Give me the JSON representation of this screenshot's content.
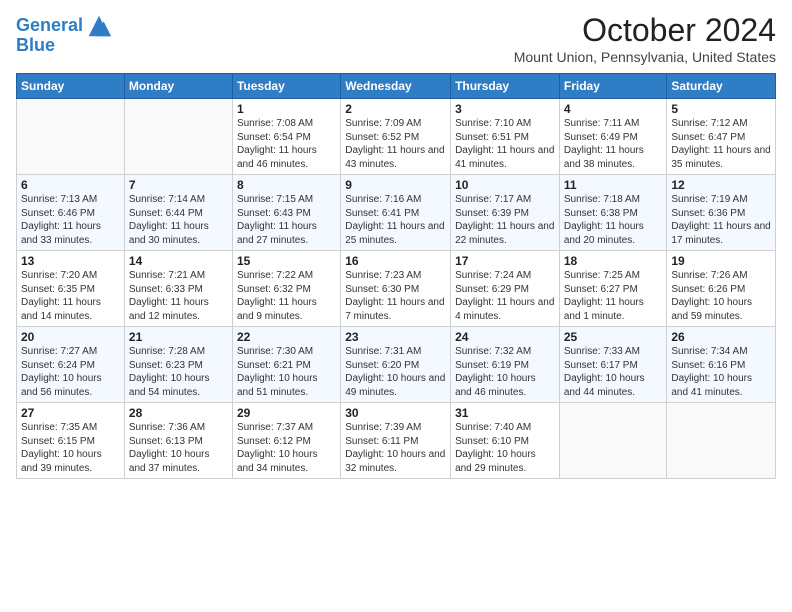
{
  "logo": {
    "line1": "General",
    "line2": "Blue"
  },
  "title": "October 2024",
  "subtitle": "Mount Union, Pennsylvania, United States",
  "days_header": [
    "Sunday",
    "Monday",
    "Tuesday",
    "Wednesday",
    "Thursday",
    "Friday",
    "Saturday"
  ],
  "weeks": [
    [
      {
        "day": "",
        "text": ""
      },
      {
        "day": "",
        "text": ""
      },
      {
        "day": "1",
        "text": "Sunrise: 7:08 AM\nSunset: 6:54 PM\nDaylight: 11 hours and 46 minutes."
      },
      {
        "day": "2",
        "text": "Sunrise: 7:09 AM\nSunset: 6:52 PM\nDaylight: 11 hours and 43 minutes."
      },
      {
        "day": "3",
        "text": "Sunrise: 7:10 AM\nSunset: 6:51 PM\nDaylight: 11 hours and 41 minutes."
      },
      {
        "day": "4",
        "text": "Sunrise: 7:11 AM\nSunset: 6:49 PM\nDaylight: 11 hours and 38 minutes."
      },
      {
        "day": "5",
        "text": "Sunrise: 7:12 AM\nSunset: 6:47 PM\nDaylight: 11 hours and 35 minutes."
      }
    ],
    [
      {
        "day": "6",
        "text": "Sunrise: 7:13 AM\nSunset: 6:46 PM\nDaylight: 11 hours and 33 minutes."
      },
      {
        "day": "7",
        "text": "Sunrise: 7:14 AM\nSunset: 6:44 PM\nDaylight: 11 hours and 30 minutes."
      },
      {
        "day": "8",
        "text": "Sunrise: 7:15 AM\nSunset: 6:43 PM\nDaylight: 11 hours and 27 minutes."
      },
      {
        "day": "9",
        "text": "Sunrise: 7:16 AM\nSunset: 6:41 PM\nDaylight: 11 hours and 25 minutes."
      },
      {
        "day": "10",
        "text": "Sunrise: 7:17 AM\nSunset: 6:39 PM\nDaylight: 11 hours and 22 minutes."
      },
      {
        "day": "11",
        "text": "Sunrise: 7:18 AM\nSunset: 6:38 PM\nDaylight: 11 hours and 20 minutes."
      },
      {
        "day": "12",
        "text": "Sunrise: 7:19 AM\nSunset: 6:36 PM\nDaylight: 11 hours and 17 minutes."
      }
    ],
    [
      {
        "day": "13",
        "text": "Sunrise: 7:20 AM\nSunset: 6:35 PM\nDaylight: 11 hours and 14 minutes."
      },
      {
        "day": "14",
        "text": "Sunrise: 7:21 AM\nSunset: 6:33 PM\nDaylight: 11 hours and 12 minutes."
      },
      {
        "day": "15",
        "text": "Sunrise: 7:22 AM\nSunset: 6:32 PM\nDaylight: 11 hours and 9 minutes."
      },
      {
        "day": "16",
        "text": "Sunrise: 7:23 AM\nSunset: 6:30 PM\nDaylight: 11 hours and 7 minutes."
      },
      {
        "day": "17",
        "text": "Sunrise: 7:24 AM\nSunset: 6:29 PM\nDaylight: 11 hours and 4 minutes."
      },
      {
        "day": "18",
        "text": "Sunrise: 7:25 AM\nSunset: 6:27 PM\nDaylight: 11 hours and 1 minute."
      },
      {
        "day": "19",
        "text": "Sunrise: 7:26 AM\nSunset: 6:26 PM\nDaylight: 10 hours and 59 minutes."
      }
    ],
    [
      {
        "day": "20",
        "text": "Sunrise: 7:27 AM\nSunset: 6:24 PM\nDaylight: 10 hours and 56 minutes."
      },
      {
        "day": "21",
        "text": "Sunrise: 7:28 AM\nSunset: 6:23 PM\nDaylight: 10 hours and 54 minutes."
      },
      {
        "day": "22",
        "text": "Sunrise: 7:30 AM\nSunset: 6:21 PM\nDaylight: 10 hours and 51 minutes."
      },
      {
        "day": "23",
        "text": "Sunrise: 7:31 AM\nSunset: 6:20 PM\nDaylight: 10 hours and 49 minutes."
      },
      {
        "day": "24",
        "text": "Sunrise: 7:32 AM\nSunset: 6:19 PM\nDaylight: 10 hours and 46 minutes."
      },
      {
        "day": "25",
        "text": "Sunrise: 7:33 AM\nSunset: 6:17 PM\nDaylight: 10 hours and 44 minutes."
      },
      {
        "day": "26",
        "text": "Sunrise: 7:34 AM\nSunset: 6:16 PM\nDaylight: 10 hours and 41 minutes."
      }
    ],
    [
      {
        "day": "27",
        "text": "Sunrise: 7:35 AM\nSunset: 6:15 PM\nDaylight: 10 hours and 39 minutes."
      },
      {
        "day": "28",
        "text": "Sunrise: 7:36 AM\nSunset: 6:13 PM\nDaylight: 10 hours and 37 minutes."
      },
      {
        "day": "29",
        "text": "Sunrise: 7:37 AM\nSunset: 6:12 PM\nDaylight: 10 hours and 34 minutes."
      },
      {
        "day": "30",
        "text": "Sunrise: 7:39 AM\nSunset: 6:11 PM\nDaylight: 10 hours and 32 minutes."
      },
      {
        "day": "31",
        "text": "Sunrise: 7:40 AM\nSunset: 6:10 PM\nDaylight: 10 hours and 29 minutes."
      },
      {
        "day": "",
        "text": ""
      },
      {
        "day": "",
        "text": ""
      }
    ]
  ]
}
